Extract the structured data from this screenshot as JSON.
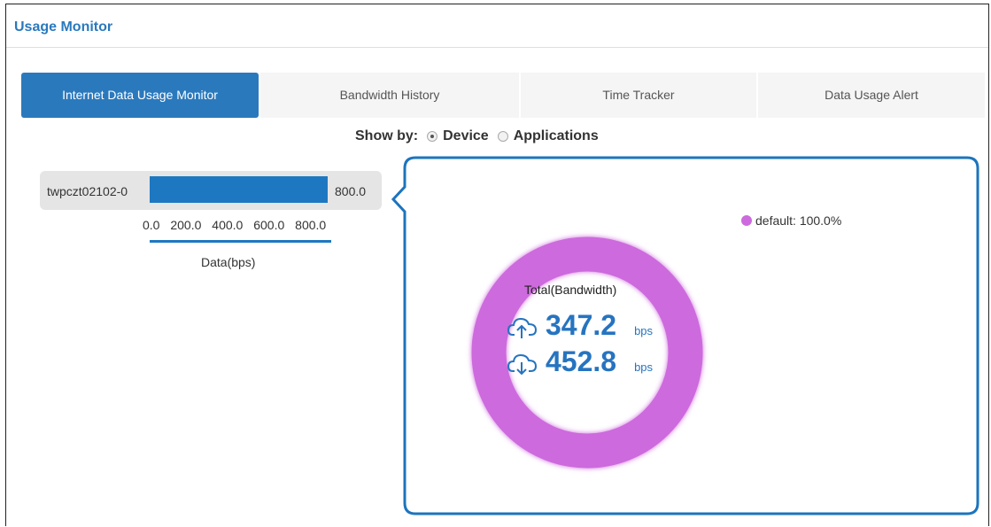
{
  "header": {
    "title": "Usage Monitor"
  },
  "tabs": [
    {
      "label": "Internet Data Usage Monitor",
      "active": true
    },
    {
      "label": "Bandwidth History",
      "active": false
    },
    {
      "label": "Time Tracker",
      "active": false
    },
    {
      "label": "Data Usage Alert",
      "active": false
    }
  ],
  "show_by": {
    "label": "Show by:",
    "options": [
      {
        "label": "Device",
        "selected": true
      },
      {
        "label": "Applications",
        "selected": false
      }
    ]
  },
  "device_chart": {
    "device_name": "twpczt02102-0",
    "value_label": "800.0",
    "ticks": [
      "0.0",
      "200.0",
      "400.0",
      "600.0",
      "800.0"
    ],
    "axis_label": "Data(bps)"
  },
  "donut": {
    "legend_label": "default: 100.0%",
    "legend_color": "#cd6add",
    "total_label": "Total(Bandwidth)",
    "upload_value": "347.2",
    "upload_unit": "bps",
    "download_value": "452.8",
    "download_unit": "bps"
  },
  "chart_data": {
    "type": "bar",
    "categories": [
      "twpczt02102-0"
    ],
    "values": [
      800.0
    ],
    "xlabel": "Data(bps)",
    "xlim": [
      0,
      800
    ]
  }
}
